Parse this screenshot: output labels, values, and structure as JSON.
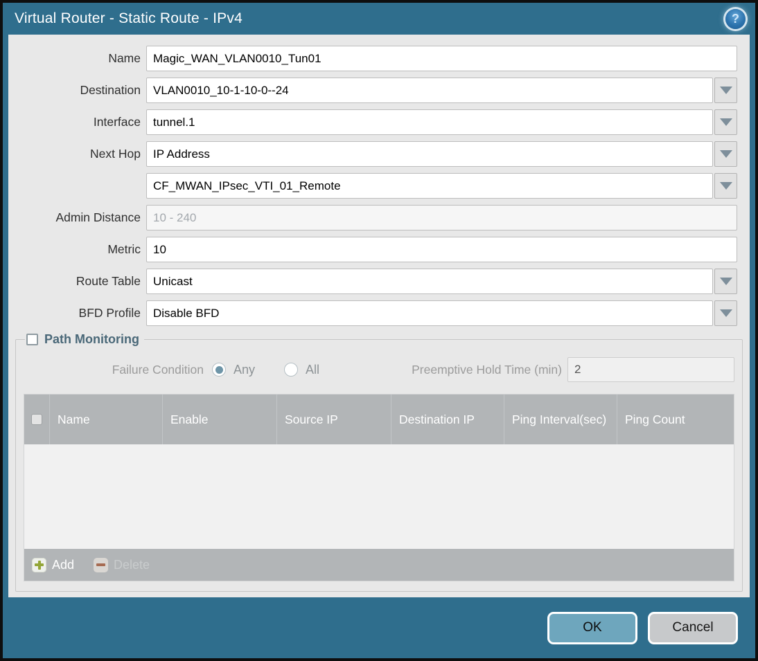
{
  "titlebar": {
    "title": "Virtual Router - Static Route - IPv4"
  },
  "form": {
    "name": {
      "label": "Name",
      "value": "Magic_WAN_VLAN0010_Tun01"
    },
    "destination": {
      "label": "Destination",
      "value": "VLAN0010_10-1-10-0--24"
    },
    "interface": {
      "label": "Interface",
      "value": "tunnel.1"
    },
    "next_hop": {
      "label": "Next Hop",
      "value": "IP Address"
    },
    "next_hop_address": {
      "value": "CF_MWAN_IPsec_VTI_01_Remote"
    },
    "admin_distance": {
      "label": "Admin Distance",
      "placeholder": "10 - 240"
    },
    "metric": {
      "label": "Metric",
      "value": "10"
    },
    "route_table": {
      "label": "Route Table",
      "value": "Unicast"
    },
    "bfd_profile": {
      "label": "BFD Profile",
      "value": "Disable BFD"
    }
  },
  "path_monitoring": {
    "title": "Path Monitoring",
    "enabled": false,
    "failure_condition": {
      "label": "Failure Condition",
      "options": [
        {
          "label": "Any",
          "selected": true
        },
        {
          "label": "All",
          "selected": false
        }
      ]
    },
    "preemptive_hold_time": {
      "label": "Preemptive Hold Time (min)",
      "value": "2"
    },
    "table": {
      "columns": [
        "Name",
        "Enable",
        "Source IP",
        "Destination IP",
        "Ping Interval(sec)",
        "Ping Count"
      ],
      "rows": []
    },
    "toolbar": {
      "add": "Add",
      "delete": "Delete"
    }
  },
  "footer": {
    "ok": "OK",
    "cancel": "Cancel"
  },
  "colors": {
    "titlebar_teal": "#2f6e8d",
    "content_bg": "#e8e8e8",
    "table_header_gray": "#b2b5b7",
    "ok_button": "#6ea6bd",
    "cancel_button": "#c7c9cb",
    "radio_selected_dot": "#6e95a8",
    "add_icon_green": "#93a637",
    "delete_icon_red": "#a66b52",
    "help_icon_blue": "#2d74ae"
  }
}
